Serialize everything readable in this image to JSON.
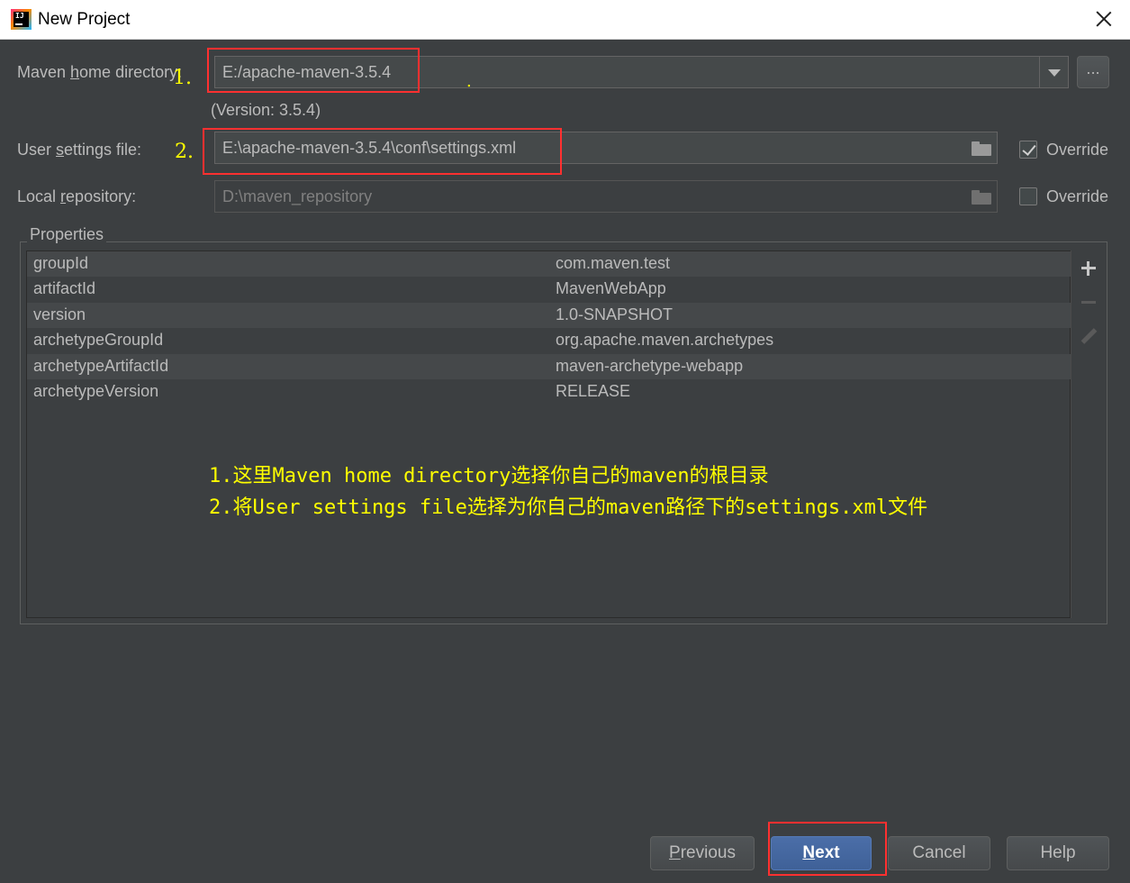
{
  "window": {
    "title": "New Project"
  },
  "form": {
    "maven_home": {
      "label_pre": "Maven ",
      "label_mn": "h",
      "label_post": "ome directory:",
      "value": "E:/apache-maven-3.5.4",
      "version": "(Version: 3.5.4)",
      "browse_label": "..."
    },
    "user_settings": {
      "label_pre": "User ",
      "label_mn": "s",
      "label_post": "ettings file:",
      "value": "E:\\apache-maven-3.5.4\\conf\\settings.xml",
      "override_label": "Override",
      "override_checked": true
    },
    "local_repo": {
      "label_pre": "Local ",
      "label_mn": "r",
      "label_post": "epository:",
      "value": "D:\\maven_repository",
      "override_label": "Override",
      "override_checked": false
    }
  },
  "properties": {
    "title": "Properties",
    "rows": [
      {
        "key": "groupId",
        "value": "com.maven.test"
      },
      {
        "key": "artifactId",
        "value": "MavenWebApp"
      },
      {
        "key": "version",
        "value": "1.0-SNAPSHOT"
      },
      {
        "key": "archetypeGroupId",
        "value": "org.apache.maven.archetypes"
      },
      {
        "key": "archetypeArtifactId",
        "value": "maven-archetype-webapp"
      },
      {
        "key": "archetypeVersion",
        "value": "RELEASE"
      }
    ]
  },
  "annotations": {
    "marker1": "1.",
    "marker2": "2.",
    "dot": ".",
    "line1": "1.这里Maven home directory选择你自己的maven的根目录",
    "line2": "2.将User settings file选择为你自己的maven路径下的settings.xml文件",
    "color": "#ffff00",
    "box_color": "#ff3030"
  },
  "buttons": {
    "previous": {
      "mn": "P",
      "rest": "revious"
    },
    "next": {
      "mn": "N",
      "rest": "ext"
    },
    "cancel": "Cancel",
    "help": "Help"
  }
}
